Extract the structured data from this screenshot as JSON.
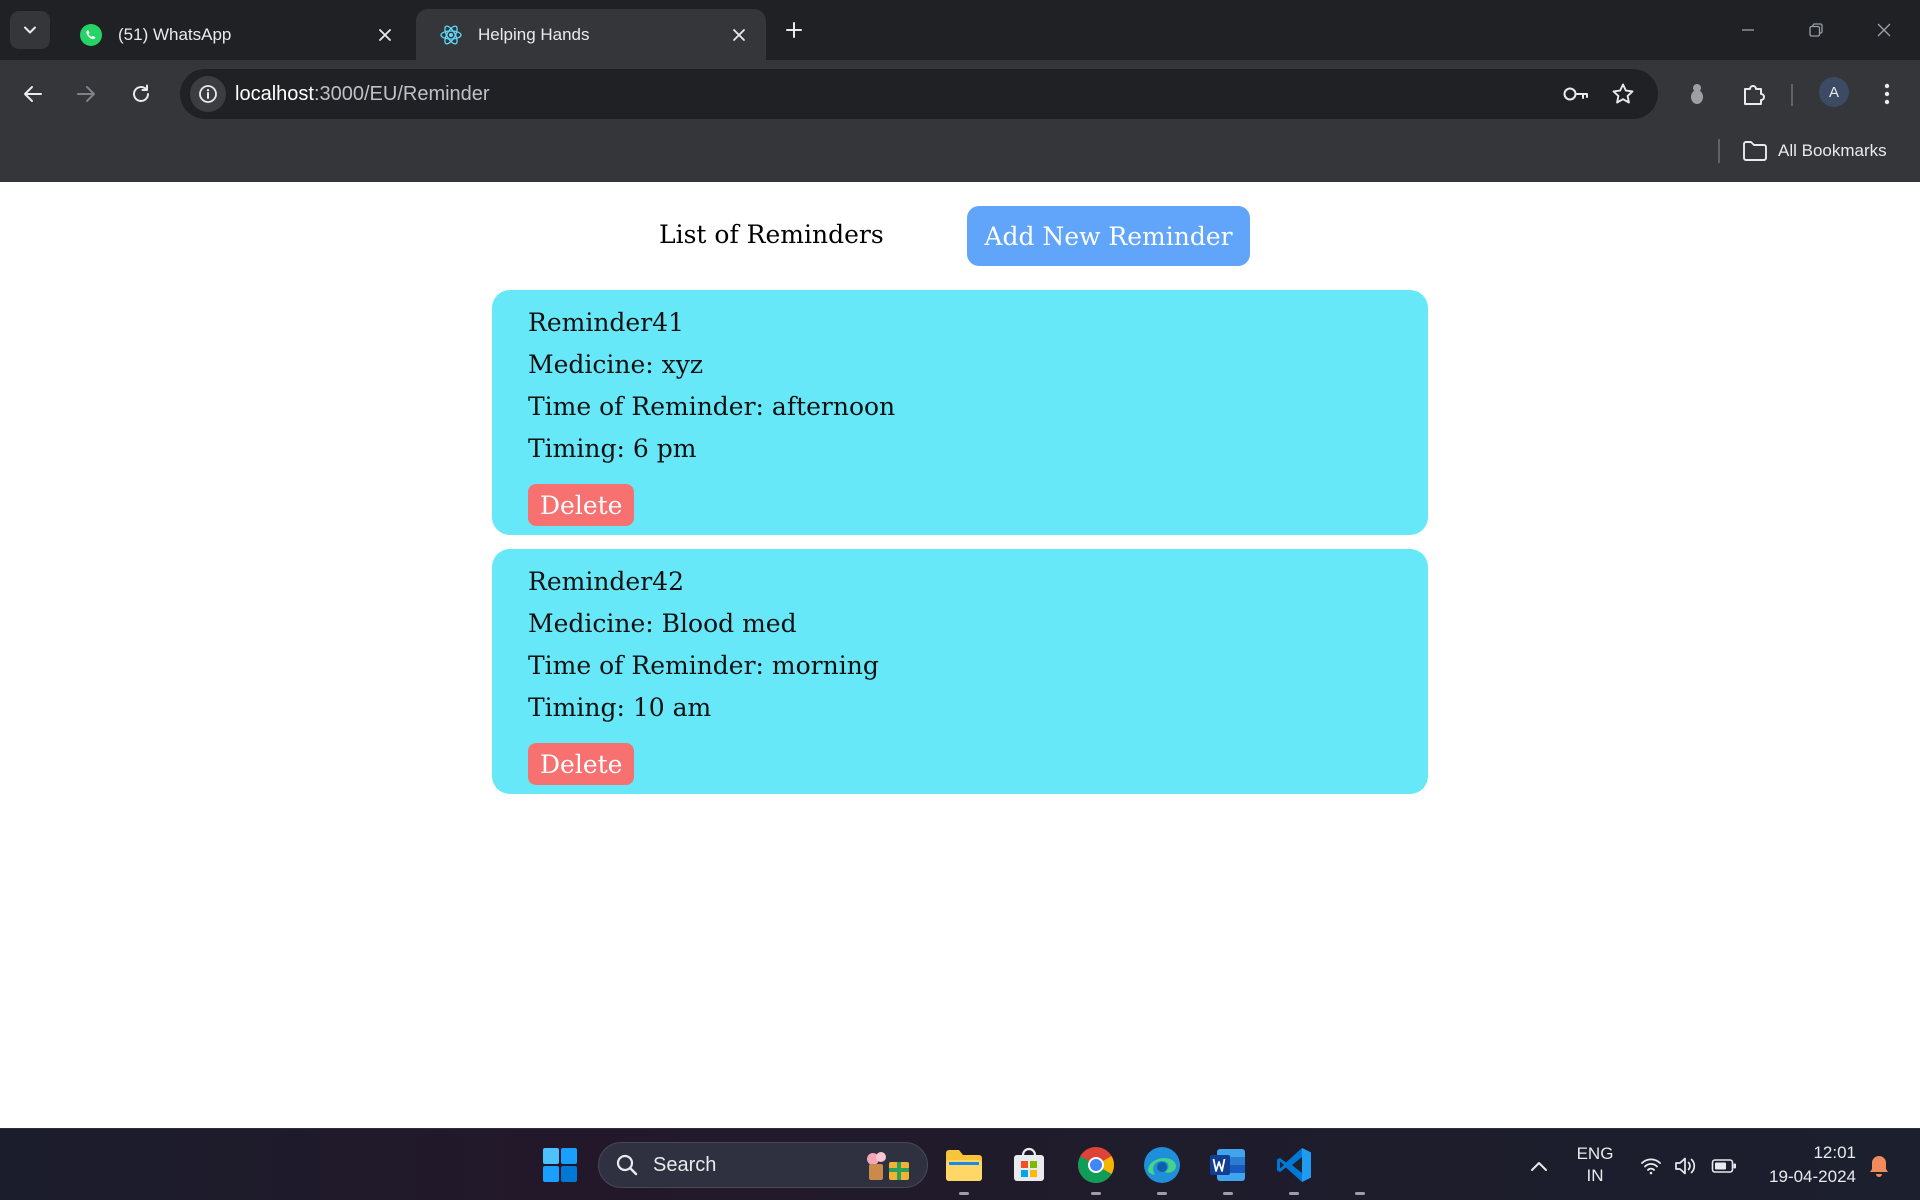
{
  "browser": {
    "tabs": [
      {
        "title": "(51) WhatsApp",
        "favicon": "whatsapp-icon",
        "active": false
      },
      {
        "title": "Helping Hands",
        "favicon": "react-icon",
        "active": true
      }
    ],
    "url_host": "localhost",
    "url_path": ":3000/EU/Reminder",
    "profile_initial": "A",
    "bookmarks_label": "All Bookmarks"
  },
  "page": {
    "list_title": "List of Reminders",
    "add_button": "Add New Reminder",
    "reminders": [
      {
        "name": "Reminder41",
        "medicine": "Medicine: xyz",
        "time_of_reminder": "Time of Reminder: afternoon",
        "timing": "Timing: 6 pm",
        "delete_label": "Delete"
      },
      {
        "name": "Reminder42",
        "medicine": "Medicine: Blood med",
        "time_of_reminder": "Time of Reminder: morning",
        "timing": "Timing: 10 am",
        "delete_label": "Delete"
      }
    ]
  },
  "taskbar": {
    "search_placeholder": "Search",
    "lang_primary": "ENG",
    "lang_secondary": "IN",
    "time": "12:01",
    "date": "19-04-2024"
  },
  "colors": {
    "card": "#67e8f9",
    "add_button": "#60a5fa",
    "delete_button": "#f87171",
    "chrome_dark": "#202124",
    "chrome_toolbar": "#35363a"
  }
}
